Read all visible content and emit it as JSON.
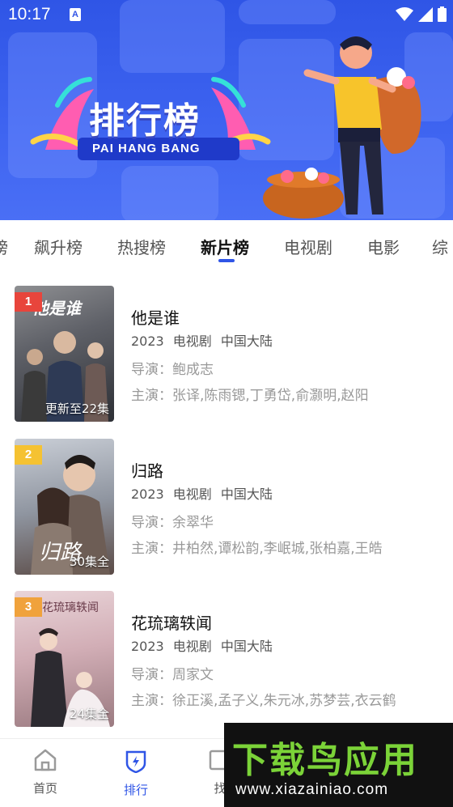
{
  "status": {
    "time": "10:17",
    "a_badge": "A"
  },
  "banner": {
    "title": "排行榜",
    "subtitle": "PAI HANG BANG"
  },
  "tabs": [
    {
      "label": "榜"
    },
    {
      "label": "飙升榜"
    },
    {
      "label": "热搜榜"
    },
    {
      "label": "新片榜",
      "active": true
    },
    {
      "label": "电视剧"
    },
    {
      "label": "电影"
    },
    {
      "label": "综"
    }
  ],
  "items": [
    {
      "rank": "1",
      "badge_color": "#e8453c",
      "title": "他是谁",
      "meta": "2023 电视剧 中国大陆",
      "director": "导演：鲍成志",
      "cast": "主演：张译,陈雨锶,丁勇岱,俞灏明,赵阳",
      "poster_note": "更新至22集",
      "poster_text": "他是谁"
    },
    {
      "rank": "2",
      "badge_color": "#f5c232",
      "title": "归路",
      "meta": "2023 电视剧 中国大陆",
      "director": "导演：余翠华",
      "cast": "主演：井柏然,谭松韵,李岷城,张柏嘉,王皓",
      "poster_note": "30集全",
      "poster_text": "归路"
    },
    {
      "rank": "3",
      "badge_color": "#f0a23c",
      "title": "花琉璃轶闻",
      "meta": "2023 电视剧 中国大陆",
      "director": "导演：周家文",
      "cast": "主演：徐正溪,孟子义,朱元冰,苏梦芸,衣云鹤",
      "poster_note": "24集全",
      "poster_text": "花琉璃轶闻"
    }
  ],
  "bottom_nav": [
    {
      "label": "首页",
      "icon": "home-icon"
    },
    {
      "label": "排行",
      "icon": "ranking-shield-icon",
      "active": true
    },
    {
      "label": "找",
      "icon": "find-icon"
    }
  ],
  "watermark": {
    "cn": "下载鸟应用",
    "en": "www.xiazainiao.com"
  },
  "colors": {
    "accent": "#2f55e6",
    "banner_bg": "#3d63f0",
    "watermark_green": "#7bd338"
  }
}
